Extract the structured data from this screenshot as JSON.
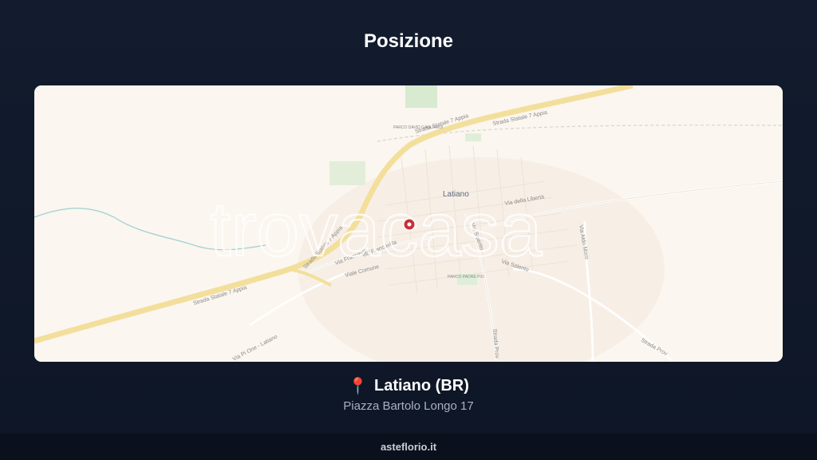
{
  "page": {
    "title": "Posizione"
  },
  "map": {
    "town_label": "Latiano",
    "watermark": "trovacasa",
    "roads": {
      "ss7_top": "Strada Statale 7 Appia",
      "ss7_top_2": "Strada Statale 7 Appia",
      "ss7_mid": "Strada Statale 7 Appia",
      "ss7_bottom": "Strada Statale 7 Appia",
      "via_liberta": "Via della Libertà",
      "via_francavilla_1": "Via Francavilla",
      "via_francavilla_2": "Via Francavilla",
      "via_salento_1": "Via Salento",
      "via_salento_2": "Via Salento",
      "via_comune": "Viale Comune",
      "via_aldo_moro": "Via Aldo Moro",
      "strada_prov": "Strada Prov",
      "strada_prov_2": "Strada Prov",
      "via_pi_one": "Via Pi One - Latiano"
    },
    "parks": {
      "north": "PARCO DAVID GAGLIARDI",
      "south": "PARCO PADRE PIO"
    },
    "pin_icon": "map-marker"
  },
  "location": {
    "icon": "round-pushpin",
    "name": "Latiano (BR)",
    "address": "Piazza Bartolo Longo 17"
  },
  "footer": {
    "brand": "asteflorio.it"
  }
}
